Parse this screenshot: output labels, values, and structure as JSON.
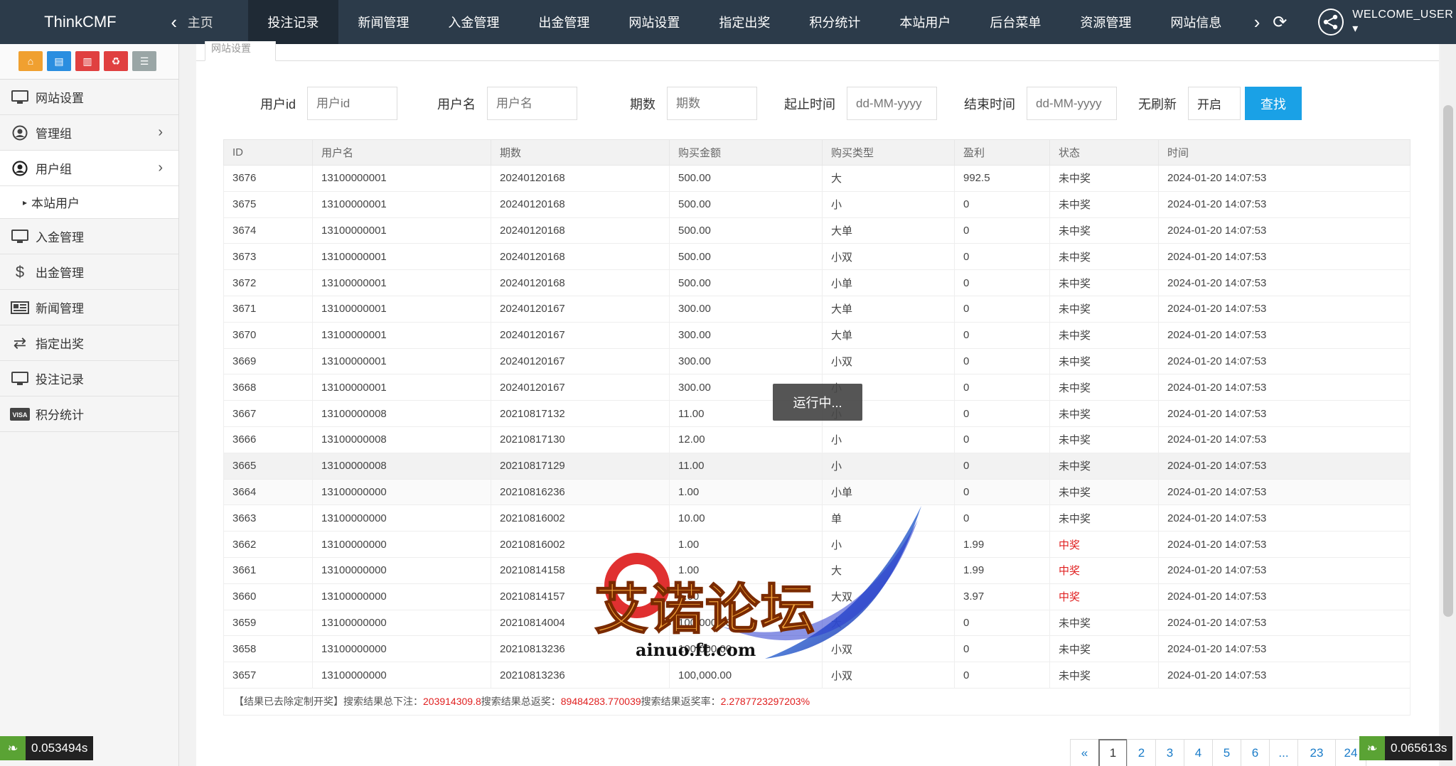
{
  "topbar": {
    "brand": "ThinkCMF",
    "home": "主页",
    "menu": [
      "投注记录",
      "新闻管理",
      "入金管理",
      "出金管理",
      "网站设置",
      "指定出奖",
      "积分统计",
      "本站用户",
      "后台菜单",
      "资源管理",
      "网站信息"
    ],
    "user": "WELCOME_USER ▾"
  },
  "sidebar": {
    "items": [
      {
        "label": "网站设置",
        "icon": "monitor-icon"
      },
      {
        "label": "管理组",
        "icon": "user-circle-icon"
      },
      {
        "label": "用户组",
        "icon": "user-circle-icon"
      },
      {
        "label": "本站用户",
        "icon": ""
      },
      {
        "label": "入金管理",
        "icon": "monitor-icon"
      },
      {
        "label": "出金管理",
        "icon": "dollar-icon"
      },
      {
        "label": "新闻管理",
        "icon": "newspaper-icon"
      },
      {
        "label": "指定出奖",
        "icon": "exchange-icon"
      },
      {
        "label": "投注记录",
        "icon": "monitor-icon"
      },
      {
        "label": "积分统计",
        "icon": "visa-icon"
      }
    ]
  },
  "tab": {
    "label": "网站设置"
  },
  "filters": {
    "user_id_label": "用户id",
    "user_id_placeholder": "用户id",
    "username_label": "用户名",
    "username_placeholder": "用户名",
    "period_label": "期数",
    "period_placeholder": "期数",
    "start_label": "起止时间",
    "start_placeholder": "dd-MM-yyyy",
    "end_label": "结束时间",
    "end_placeholder": "dd-MM-yyyy",
    "refresh_label": "无刷新",
    "refresh_value": "开启",
    "search_button": "查找"
  },
  "table": {
    "headers": [
      "ID",
      "用户名",
      "期数",
      "购买金额",
      "购买类型",
      "盈利",
      "状态",
      "时间"
    ],
    "rows": [
      [
        "3676",
        "13100000001",
        "20240120168",
        "500.00",
        "大",
        "992.5",
        "未中奖",
        "2024-01-20 14:07:53"
      ],
      [
        "3675",
        "13100000001",
        "20240120168",
        "500.00",
        "小",
        "0",
        "未中奖",
        "2024-01-20 14:07:53"
      ],
      [
        "3674",
        "13100000001",
        "20240120168",
        "500.00",
        "大单",
        "0",
        "未中奖",
        "2024-01-20 14:07:53"
      ],
      [
        "3673",
        "13100000001",
        "20240120168",
        "500.00",
        "小双",
        "0",
        "未中奖",
        "2024-01-20 14:07:53"
      ],
      [
        "3672",
        "13100000001",
        "20240120168",
        "500.00",
        "小单",
        "0",
        "未中奖",
        "2024-01-20 14:07:53"
      ],
      [
        "3671",
        "13100000001",
        "20240120167",
        "300.00",
        "大单",
        "0",
        "未中奖",
        "2024-01-20 14:07:53"
      ],
      [
        "3670",
        "13100000001",
        "20240120167",
        "300.00",
        "大单",
        "0",
        "未中奖",
        "2024-01-20 14:07:53"
      ],
      [
        "3669",
        "13100000001",
        "20240120167",
        "300.00",
        "小双",
        "0",
        "未中奖",
        "2024-01-20 14:07:53"
      ],
      [
        "3668",
        "13100000001",
        "20240120167",
        "300.00",
        "小",
        "0",
        "未中奖",
        "2024-01-20 14:07:53"
      ],
      [
        "3667",
        "13100000008",
        "20210817132",
        "11.00",
        "小",
        "0",
        "未中奖",
        "2024-01-20 14:07:53"
      ],
      [
        "3666",
        "13100000008",
        "20210817130",
        "12.00",
        "小",
        "0",
        "未中奖",
        "2024-01-20 14:07:53"
      ],
      [
        "3665",
        "13100000008",
        "20210817129",
        "11.00",
        "小",
        "0",
        "未中奖",
        "2024-01-20 14:07:53"
      ],
      [
        "3664",
        "13100000000",
        "20210816236",
        "1.00",
        "小单",
        "0",
        "未中奖",
        "2024-01-20 14:07:53"
      ],
      [
        "3663",
        "13100000000",
        "20210816002",
        "10.00",
        "单",
        "0",
        "未中奖",
        "2024-01-20 14:07:53"
      ],
      [
        "3662",
        "13100000000",
        "20210816002",
        "1.00",
        "小",
        "1.99",
        "中奖",
        "2024-01-20 14:07:53"
      ],
      [
        "3661",
        "13100000000",
        "20210814158",
        "1.00",
        "大",
        "1.99",
        "中奖",
        "2024-01-20 14:07:53"
      ],
      [
        "3660",
        "13100000000",
        "20210814157",
        "1.00",
        "大双",
        "3.97",
        "中奖",
        "2024-01-20 14:07:53"
      ],
      [
        "3659",
        "13100000000",
        "20210814004",
        "100,000.00",
        "大",
        "0",
        "未中奖",
        "2024-01-20 14:07:53"
      ],
      [
        "3658",
        "13100000000",
        "20210813236",
        "100,000.00",
        "小双",
        "0",
        "未中奖",
        "2024-01-20 14:07:53"
      ],
      [
        "3657",
        "13100000000",
        "20210813236",
        "100,000.00",
        "小双",
        "0",
        "未中奖",
        "2024-01-20 14:07:53"
      ]
    ]
  },
  "summary": {
    "prefix": "【结果已去除定制开奖】搜索结果总下注：",
    "total_bet": "203914309.8",
    "mid1": " 搜索结果总返奖：",
    "total_return": "89484283.770039",
    "mid2": " 搜索结果返奖率：",
    "return_rate": "2.2787723297203%"
  },
  "loading": "运行中...",
  "pager": [
    "«",
    "1",
    "2",
    "3",
    "4",
    "5",
    "6",
    "...",
    "23",
    "24"
  ],
  "timers": {
    "left": "0.053494s",
    "right": "0.065613s"
  },
  "watermark": {
    "title": "艾诺论坛",
    "domain": "ainuo.ft.com"
  },
  "colors": {
    "topbar": "#2c3b4a",
    "accent": "#1aa1e6",
    "won": "#e02020"
  }
}
